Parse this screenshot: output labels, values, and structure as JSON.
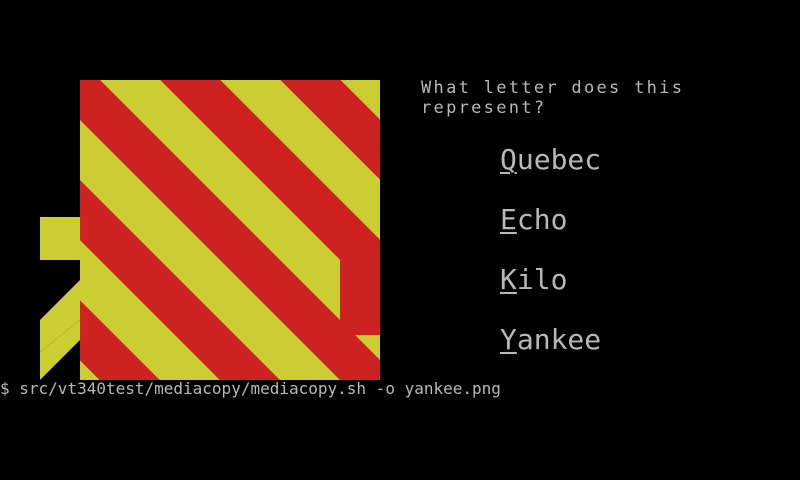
{
  "flag": {
    "icon": "yankee-signal-flag-icon",
    "colors": {
      "red": "#cc2222",
      "yellow": "#cccc33",
      "background": "#000000"
    }
  },
  "quiz": {
    "question": "What letter does this represent?",
    "options": [
      {
        "key": "Q",
        "rest": "uebec"
      },
      {
        "key": "E",
        "rest": "cho"
      },
      {
        "key": "K",
        "rest": "ilo"
      },
      {
        "key": "Y",
        "rest": "ankee"
      }
    ]
  },
  "terminal": {
    "command": "$ src/vt340test/mediacopy/mediacopy.sh -o yankee.png",
    "text_color": "#b8b8b8"
  }
}
